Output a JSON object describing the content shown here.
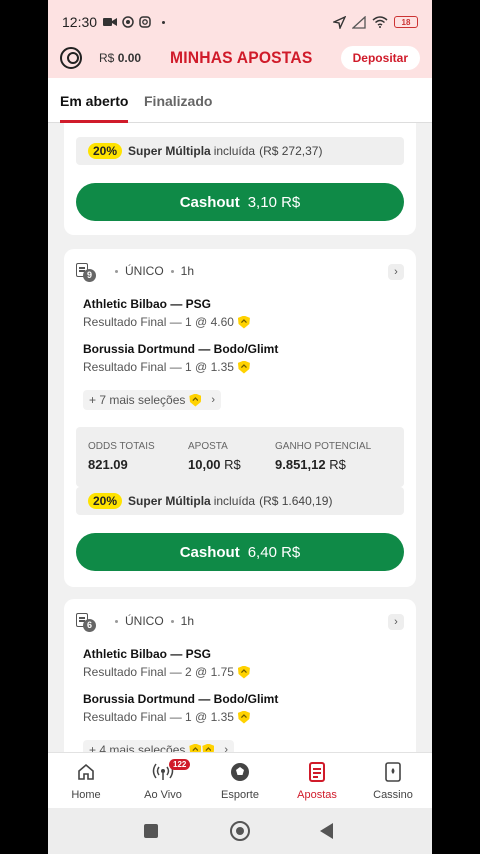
{
  "status_bar": {
    "time": "12:30",
    "battery": "18"
  },
  "header": {
    "balance_currency": "R$",
    "balance_amount": "0.00",
    "title": "MINHAS APOSTAS",
    "deposit_label": "Depositar"
  },
  "tabs": [
    {
      "label": "Em aberto"
    },
    {
      "label": "Finalizado"
    }
  ],
  "bet0": {
    "promo_pct": "20%",
    "promo_name": "Super Múltipla",
    "promo_included": "incluída",
    "promo_value": "(R$ 272,37)",
    "cashout_label": "Cashout",
    "cashout_value": "3,10 R$"
  },
  "bet1": {
    "count": "9",
    "type": "ÚNICO",
    "age": "1h",
    "selections": [
      {
        "match": "Athletic Bilbao — PSG",
        "market": "Resultado Final — 1 @ 4.60"
      },
      {
        "match": "Borussia Dortmund — Bodo/Glimt",
        "market": "Resultado Final — 1 @ 1.35"
      }
    ],
    "more_label": "+ 7 mais seleções",
    "odds_label": "ODDS TOTAIS",
    "odds_value": "821.09",
    "stake_label": "APOSTA",
    "stake_value": "10,00",
    "stake_cur": "R$",
    "win_label": "GANHO POTENCIAL",
    "win_value": "9.851,12",
    "win_cur": "R$",
    "promo_pct": "20%",
    "promo_name": "Super Múltipla",
    "promo_included": "incluída",
    "promo_value": "(R$ 1.640,19)",
    "cashout_label": "Cashout",
    "cashout_value": "6,40 R$"
  },
  "bet2": {
    "count": "6",
    "type": "ÚNICO",
    "age": "1h",
    "selections": [
      {
        "match": "Athletic Bilbao — PSG",
        "market": "Resultado Final — 2 @ 1.75"
      },
      {
        "match": "Borussia Dortmund — Bodo/Glimt",
        "market": "Resultado Final — 1 @ 1.35"
      }
    ],
    "more_label": "+ 4 mais seleções"
  },
  "bottom_nav": [
    {
      "label": "Home",
      "icon": "home-icon"
    },
    {
      "label": "Ao Vivo",
      "icon": "live-icon",
      "badge": "122"
    },
    {
      "label": "Esporte",
      "icon": "soccer-ball-icon"
    },
    {
      "label": "Apostas",
      "icon": "bets-icon",
      "active": true
    },
    {
      "label": "Cassino",
      "icon": "cards-icon"
    }
  ],
  "colors": {
    "brand_red": "#d01b2a",
    "cashout_green": "#0f8a47",
    "promo_yellow": "#ffe300",
    "header_pink": "#fde2e2"
  }
}
